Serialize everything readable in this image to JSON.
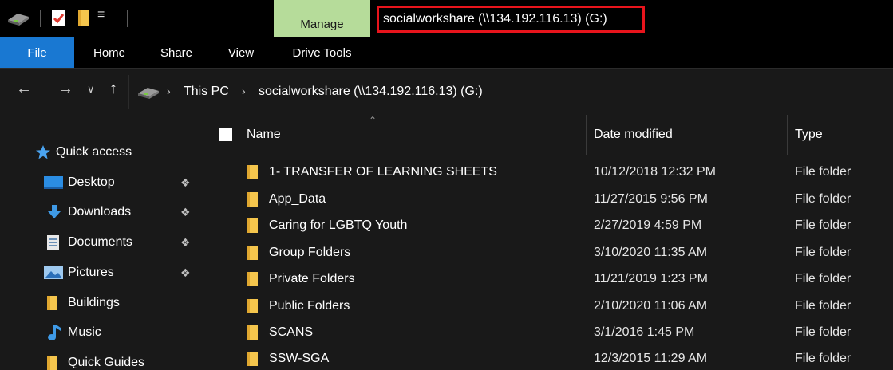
{
  "title_bar": {
    "manage_tab": "Manage",
    "window_title": "socialworkshare (\\\\134.192.116.13) (G:)"
  },
  "ribbon": {
    "tabs": [
      {
        "label": "File"
      },
      {
        "label": "Home"
      },
      {
        "label": "Share"
      },
      {
        "label": "View"
      },
      {
        "label": "Drive Tools"
      }
    ]
  },
  "address_bar": {
    "crumbs": [
      {
        "label": "This PC"
      },
      {
        "label": "socialworkshare (\\\\134.192.116.13) (G:)"
      }
    ]
  },
  "nav_pane": {
    "quick_access": "Quick access",
    "items": [
      {
        "label": "Desktop",
        "icon": "desktop-icon",
        "pinned": true
      },
      {
        "label": "Downloads",
        "icon": "download-icon",
        "pinned": true
      },
      {
        "label": "Documents",
        "icon": "document-icon",
        "pinned": true
      },
      {
        "label": "Pictures",
        "icon": "picture-icon",
        "pinned": true
      },
      {
        "label": "Buildings",
        "icon": "folder-icon",
        "pinned": false
      },
      {
        "label": "Music",
        "icon": "music-icon",
        "pinned": false
      },
      {
        "label": "Quick Guides",
        "icon": "folder-icon",
        "pinned": false
      }
    ]
  },
  "file_list": {
    "columns": [
      "Name",
      "Date modified",
      "Type"
    ],
    "rows": [
      {
        "name": "1- TRANSFER OF LEARNING SHEETS",
        "date": "10/12/2018 12:32 PM",
        "type": "File folder"
      },
      {
        "name": "App_Data",
        "date": "11/27/2015 9:56 PM",
        "type": "File folder"
      },
      {
        "name": "Caring for LGBTQ Youth",
        "date": "2/27/2019 4:59 PM",
        "type": "File folder"
      },
      {
        "name": "Group Folders",
        "date": "3/10/2020 11:35 AM",
        "type": "File folder"
      },
      {
        "name": "Private Folders",
        "date": "11/21/2019 1:23 PM",
        "type": "File folder"
      },
      {
        "name": "Public Folders",
        "date": "2/10/2020 11:06 AM",
        "type": "File folder"
      },
      {
        "name": "SCANS",
        "date": "3/1/2016 1:45 PM",
        "type": "File folder"
      },
      {
        "name": "SSW-SGA",
        "date": "12/3/2015 11:29 AM",
        "type": "File folder"
      }
    ]
  },
  "colors": {
    "file_tab": "#1978d2",
    "manage_tab": "#b6dc9a",
    "highlight_border": "#e8141c",
    "folder": "#f5c64d",
    "star": "#4aa3ef"
  }
}
